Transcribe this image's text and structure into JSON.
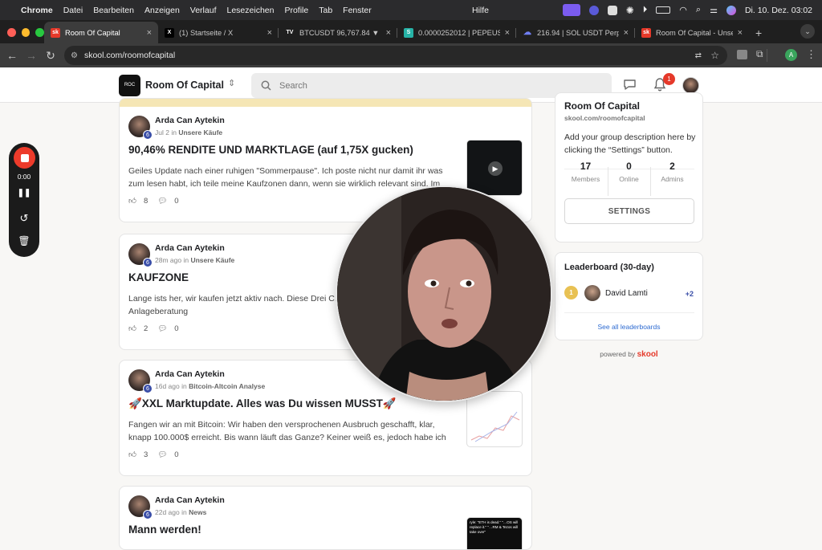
{
  "menubar": {
    "app": "Chrome",
    "items": [
      "Datei",
      "Bearbeiten",
      "Anzeigen",
      "Verlauf",
      "Lesezeichen",
      "Profile",
      "Tab",
      "Fenster"
    ],
    "help": "Hilfe",
    "datetime": "Di. 10. Dez. 03:02"
  },
  "tabs": [
    {
      "label": "Room Of Capital",
      "icon": "sk",
      "close": "×",
      "active": true
    },
    {
      "label": "(1) Startseite / X",
      "icon": "X",
      "close": "×",
      "active": false
    },
    {
      "label": "BTCUSDT 96,767.84 ▼ -…",
      "icon": "TV",
      "close": "×",
      "active": false
    },
    {
      "label": "0.0000252012 | PEPEUSD…",
      "icon": "S",
      "close": "×",
      "active": false
    },
    {
      "label": "216.94 | SOL USDT Perpe…",
      "icon": "☁",
      "close": "×",
      "active": false
    },
    {
      "label": "Room Of Capital - Unsere…",
      "icon": "sk",
      "close": "×",
      "active": false
    }
  ],
  "new_tab": "+",
  "url": "skool.com/roomofcapital",
  "header": {
    "logo_text": "ROC",
    "group_name": "Room Of Capital",
    "search_placeholder": "Search",
    "notification_count": "1"
  },
  "posts": [
    {
      "author": "Arda Can Aytekin",
      "level": "6",
      "time": "Jul 2",
      "in": "in",
      "category": "Unsere Käufe",
      "title": "90,46% RENDITE UND MARKTLAGE (auf 1,75X gucken)",
      "body": "Geiles Update nach einer ruhigen \"Sommerpause\". Ich poste nicht nur damit ihr was zum lesen habt, ich teile meine Kaufzonen dann, wenn sie wirklich relevant sind. Im",
      "likes": "8",
      "comments": "0"
    },
    {
      "author": "Arda Can Aytekin",
      "level": "6",
      "time": "28m ago",
      "in": "in",
      "category": "Unsere Käufe",
      "title": "KAUFZONE",
      "body": "Lange ists her, wir kaufen jetzt aktiv nach. Diese Drei C… Anlageberatung",
      "likes": "2",
      "comments": "0"
    },
    {
      "author": "Arda Can Aytekin",
      "level": "6",
      "time": "16d ago",
      "in": "in",
      "category": "Bitcoin-Altcoin Analyse",
      "title": "🚀XXL Marktupdate. Alles was Du wissen MUSST🚀",
      "body": "Fangen wir an mit Bitcoin: Wir haben den versprochenen Ausbruch geschafft, klar, knapp 100.000$ erreicht. Bis wann läuft das Ganze? Keiner weiß es, jedoch habe ich",
      "likes": "3",
      "comments": "0"
    },
    {
      "author": "Arda Can Aytekin",
      "level": "6",
      "time": "22d ago",
      "in": "in",
      "category": "News",
      "title": "Mann werden!",
      "body": "",
      "likes": "",
      "comments": ""
    }
  ],
  "thumb4_text": "ryle: \"ETH is dead.\" \"…OS will replace it.\" \"…RM & Tezos will take over\"",
  "recorder": {
    "time": "0:00"
  },
  "group_card": {
    "name": "Room Of Capital",
    "url": "skool.com/roomofcapital",
    "description": "Add your group description here by clicking the “Settings” button.",
    "stats": [
      {
        "value": "17",
        "label": "Members"
      },
      {
        "value": "0",
        "label": "Online"
      },
      {
        "value": "2",
        "label": "Admins"
      }
    ],
    "settings_label": "SETTINGS"
  },
  "leaderboard": {
    "title": "Leaderboard (30-day)",
    "rank": "1",
    "name": "David Lamti",
    "points": "+2",
    "see_all": "See all leaderboards"
  },
  "powered_by": {
    "prefix": "powered by",
    "brand": "skool"
  },
  "colors": {
    "accent": "#e5392a",
    "link": "#2e6bd1",
    "record": "#ed3b2b",
    "gold": "#e8c153"
  }
}
